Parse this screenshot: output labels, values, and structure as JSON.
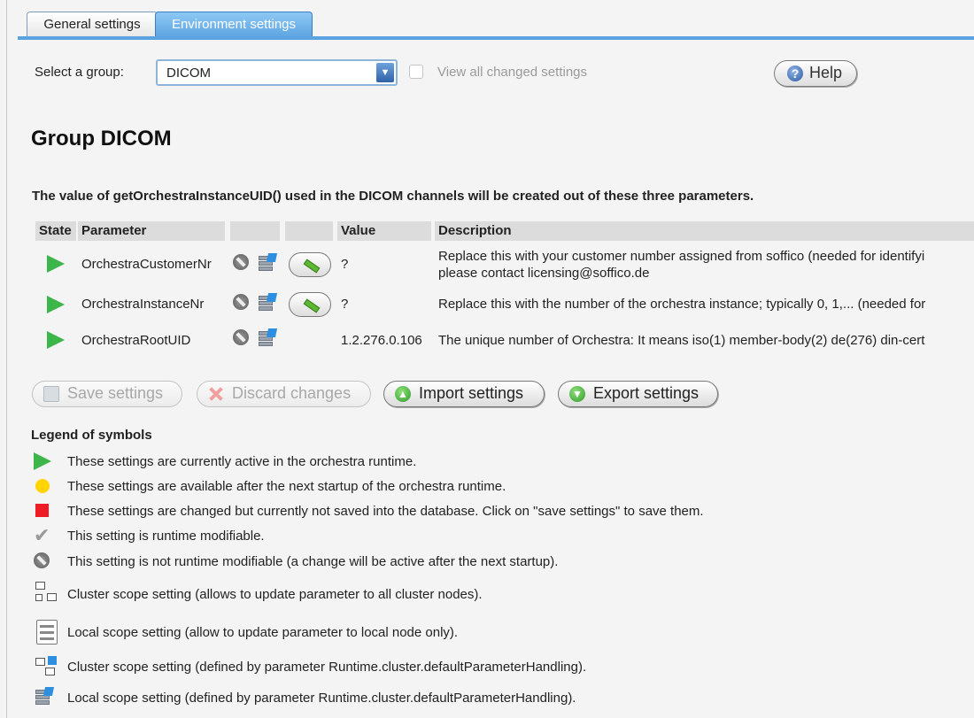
{
  "tabs": [
    {
      "label": "General settings",
      "active": false
    },
    {
      "label": "Environment settings",
      "active": true
    }
  ],
  "group_selector": {
    "label": "Select a group:",
    "value": "DICOM",
    "view_all_label": "View all changed settings",
    "view_all_checked": false
  },
  "help_label": "Help",
  "title": "Group DICOM",
  "intro": "The value of getOrchestraInstanceUID() used in the DICOM channels will be created out of these three parameters.",
  "table": {
    "headers": [
      "State",
      "Parameter",
      "",
      "",
      "Value",
      "Description"
    ],
    "rows": [
      {
        "state": "active",
        "parameter": "OrchestraCustomerNr",
        "value": "?",
        "description": "Replace this with your customer number assigned from soffico (needed for identifyi",
        "description2": "please contact licensing@soffico.de",
        "editable": true
      },
      {
        "state": "active",
        "parameter": "OrchestraInstanceNr",
        "value": "?",
        "description": "Replace this with the number of the orchestra instance; typically 0, 1,... (needed for",
        "editable": true
      },
      {
        "state": "active",
        "parameter": "OrchestraRootUID",
        "value": "1.2.276.0.106",
        "description": "The unique number of Orchestra: It means iso(1) member-body(2) de(276) din-cert",
        "editable": false
      }
    ]
  },
  "buttons": {
    "save": "Save settings",
    "discard": "Discard changes",
    "import": "Import settings",
    "export": "Export settings"
  },
  "legend": {
    "title": "Legend of symbols",
    "items": [
      "These settings are currently active in the orchestra runtime.",
      "These settings are available after the next startup of the orchestra runtime.",
      "These settings are changed but currently not saved into the database. Click on \"save settings\" to save them.",
      "This setting is runtime modifiable.",
      "This setting is not runtime modifiable (a change will be active after the next startup).",
      "Cluster scope setting (allows to update parameter to all cluster nodes).",
      "Local scope setting (allow to update parameter to local node only).",
      "Cluster scope setting (defined by parameter Runtime.cluster.defaultParameterHandling).",
      "Local scope setting (defined by parameter Runtime.cluster.defaultParameterHandling)."
    ]
  },
  "colors": {
    "tab_active": "#5fa6e2",
    "active_green": "#3cb54a",
    "pending_yellow": "#ffd400",
    "changed_red": "#ee1c25"
  }
}
